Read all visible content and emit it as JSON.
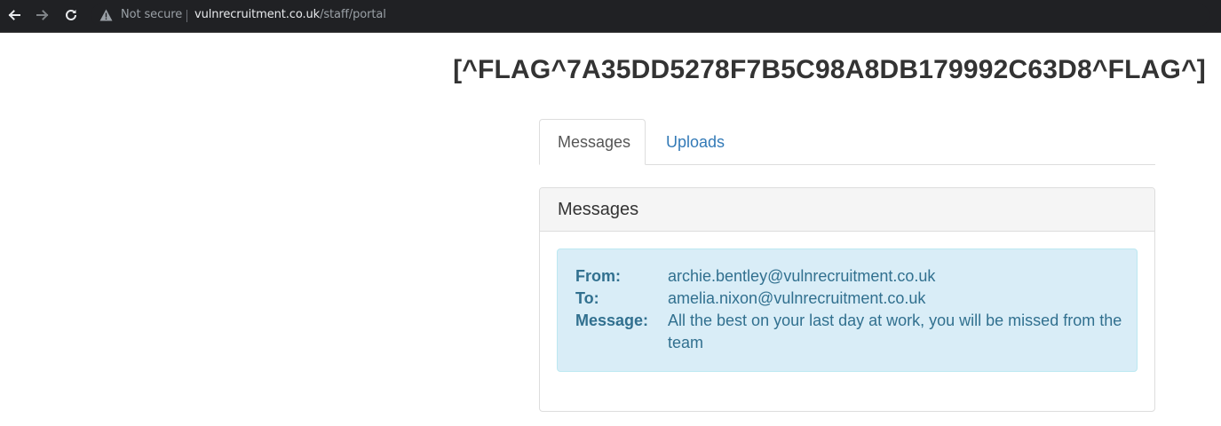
{
  "browser": {
    "security_label": "Not secure",
    "url_host": "vulnrecruitment.co.uk",
    "url_path": "/staff/portal",
    "icons": [
      "back-arrow-icon",
      "forward-arrow-icon",
      "reload-icon",
      "warning-icon"
    ]
  },
  "page": {
    "title": "[^FLAG^7A35DD5278F7B5C98A8DB179992C63D8^FLAG^]"
  },
  "tabs": [
    {
      "label": "Messages",
      "active": true
    },
    {
      "label": "Uploads",
      "active": false
    }
  ],
  "panel": {
    "heading": "Messages",
    "message": {
      "from_label": "From:",
      "from_value": "archie.bentley@vulnrecruitment.co.uk",
      "to_label": "To:",
      "to_value": "amelia.nixon@vulnrecruitment.co.uk",
      "body_label": "Message:",
      "body_value": "All the best on your last day at work, you will be missed from the team"
    }
  },
  "colors": {
    "browser_bar": "#202124",
    "link": "#337ab7",
    "alert_bg": "#d9edf7",
    "alert_text": "#31708f"
  }
}
